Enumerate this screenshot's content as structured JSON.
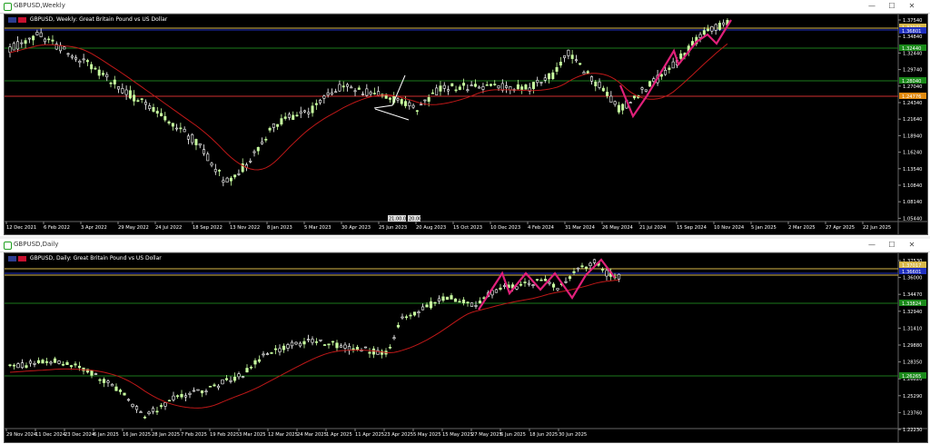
{
  "colors": {
    "bg": "#000000",
    "bull": "#c8ffa0",
    "bear": "#ffffff",
    "ma": "#c01818",
    "zigzag": "#e0207a",
    "hline_gold": "#d8b84a",
    "hline_green": "#1b7a1b",
    "hline_red": "#d03030",
    "tag_blue": "#2030c0",
    "tag_orange": "#e08a10",
    "tag_green": "#1a8a1a"
  },
  "weekly": {
    "window_title": "GBPUSD,Weekly",
    "header": "GBPUSD, Weekly: Great Britain Pound vs US Dollar",
    "controls": [
      "—",
      "☐",
      "✕"
    ],
    "price_labels": [
      "1.37540",
      "1.34840",
      "1.32440",
      "1.29740",
      "1.27040",
      "1.24340",
      "1.21640",
      "1.18940",
      "1.16240",
      "1.13540",
      "1.10840",
      "1.08140",
      "1.05440"
    ],
    "date_labels": [
      "12 Dec 2021",
      "6 Feb 2022",
      "3 Apr 2022",
      "29 May 2022",
      "24 Jul 2022",
      "18 Sep 2022",
      "13 Nov 2022",
      "8 Jan 2023",
      "5 Mar 2023",
      "30 Apr 2023",
      "25 Jun 2023",
      "20 Aug 2023",
      "15 Oct 2023",
      "10 Dec 2023",
      "4 Feb 2024",
      "31 Mar 2024",
      "26 May 2024",
      "21 Jul 2024",
      "15 Sep 2024",
      "10 Nov 2024",
      "5 Jan 2025",
      "2 Mar 2025",
      "27 Apr 2025",
      "22 Jun 2025"
    ],
    "tags": [
      {
        "text": "1.37071",
        "kind": "gold"
      },
      {
        "text": "1.36801",
        "kind": "blue"
      },
      {
        "text": "1.32440",
        "kind": "green"
      },
      {
        "text": "1.28040",
        "kind": "green"
      },
      {
        "text": "1.24776",
        "kind": "orange"
      }
    ],
    "crosshair_box": [
      "21.00.00",
      "20.00"
    ]
  },
  "daily": {
    "window_title": "GBPUSD,Daily",
    "header": "GBPUSD, Daily: Great Britain Pound vs US Dollar",
    "controls": [
      "—",
      "☐",
      "✕"
    ],
    "price_labels": [
      "1.37530",
      "1.36000",
      "1.34470",
      "1.32940",
      "1.31410",
      "1.29880",
      "1.28350",
      "1.26820",
      "1.25290",
      "1.23760",
      "1.22230"
    ],
    "date_labels": [
      "29 Nov 2024",
      "11 Dec 2024",
      "23 Dec 2024",
      "6 Jan 2025",
      "16 Jan 2025",
      "28 Jan 2025",
      "7 Feb 2025",
      "19 Feb 2025",
      "3 Mar 2025",
      "12 Mar 2025",
      "24 Mar 2025",
      "1 Apr 2025",
      "11 Apr 2025",
      "23 Apr 2025",
      "5 May 2025",
      "15 May 2025",
      "27 May 2025",
      "6 Jun 2025",
      "18 Jun 2025",
      "30 Jun 2025"
    ],
    "tags": [
      {
        "text": "1.37017",
        "kind": "gold"
      },
      {
        "text": "1.36601",
        "kind": "blue"
      },
      {
        "text": "1.33824",
        "kind": "green"
      },
      {
        "text": "1.26265",
        "kind": "green"
      }
    ]
  }
}
